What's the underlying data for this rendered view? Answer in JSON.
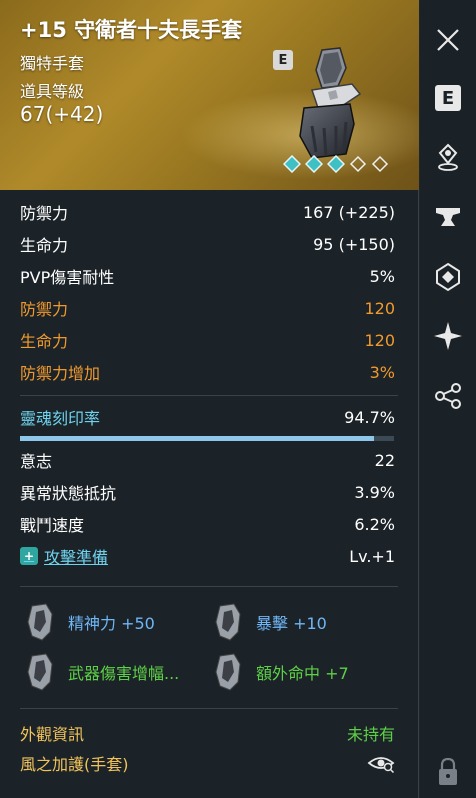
{
  "item": {
    "title": "+15 守衛者十夫長手套",
    "rarity": "獨特手套",
    "level_label": "道具等級",
    "level_value": "67(+42)",
    "grade_badge": "E",
    "gems_filled": 3,
    "gems_total": 5
  },
  "stats": [
    {
      "label": "防禦力",
      "value": "167 (+225)",
      "style": "white"
    },
    {
      "label": "生命力",
      "value": "95 (+150)",
      "style": "white"
    },
    {
      "label": "PVP傷害耐性",
      "value": "5%",
      "style": "white"
    },
    {
      "label": "防禦力",
      "value": "120",
      "style": "orange"
    },
    {
      "label": "生命力",
      "value": "120",
      "style": "orange"
    },
    {
      "label": "防禦力增加",
      "value": "3%",
      "style": "orange"
    }
  ],
  "soul": {
    "label": "靈魂刻印率",
    "value": "94.7%",
    "fill_fraction": 0.947
  },
  "soul_stats": [
    {
      "label": "意志",
      "value": "22"
    },
    {
      "label": "異常狀態抵抗",
      "value": "3.9%"
    },
    {
      "label": "戰鬥速度",
      "value": "6.2%"
    }
  ],
  "skill": {
    "label": "攻擊準備",
    "value": "Lv.+1"
  },
  "bonuses": [
    {
      "text": "精神力 +50",
      "color": "#6fb6f6"
    },
    {
      "text": "暴擊 +10",
      "color": "#6fb6f6"
    },
    {
      "text": "武器傷害增幅...",
      "color": "#5ed046"
    },
    {
      "text": "額外命中 +7",
      "color": "#5ed046"
    }
  ],
  "appearance": {
    "label": "外觀資訊",
    "status": "未持有",
    "name": "風之加護(手套)"
  },
  "toolbar": {
    "enchant_letter": "E"
  },
  "colors": {
    "orange": "#f09a2e",
    "teal": "#6fd3ee",
    "blue_bonus": "#6fb6f6",
    "green_bonus": "#5ed046",
    "gold_label": "#f0c35a",
    "bar_fill": "#8fc7ea"
  }
}
